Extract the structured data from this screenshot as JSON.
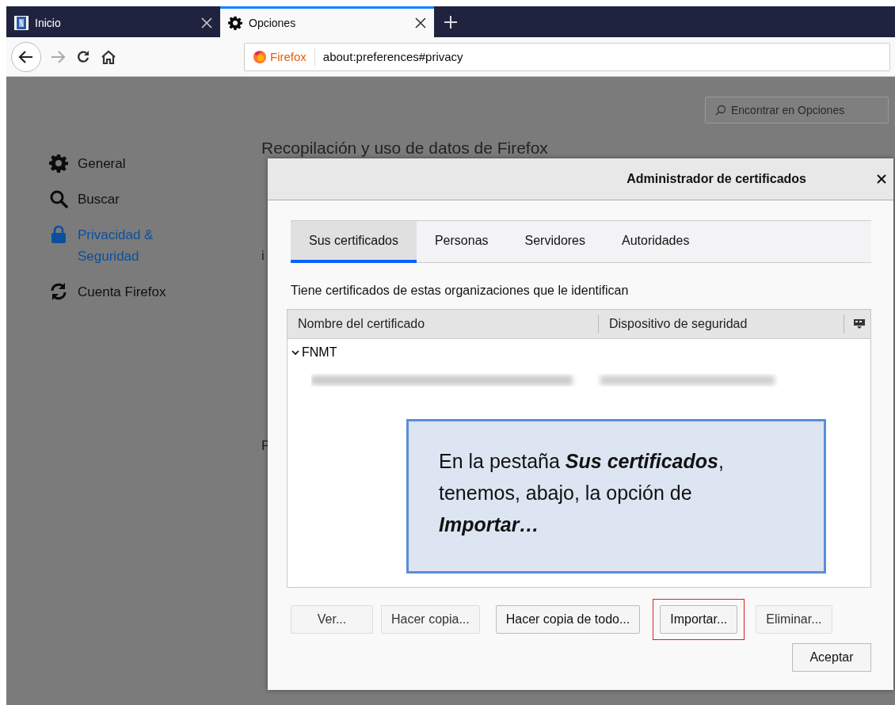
{
  "browser_tabs": [
    {
      "title": "Inicio",
      "kind": "site",
      "selected": false
    },
    {
      "title": "Opciones",
      "kind": "gear",
      "selected": true
    }
  ],
  "address_bar": {
    "identity": "Firefox",
    "url": "about:preferences#privacy"
  },
  "search": {
    "placeholder": "Encontrar en Opciones"
  },
  "sidebar": {
    "items": [
      {
        "label": "General",
        "kind": "gear",
        "selected": false
      },
      {
        "label": "Buscar",
        "kind": "search",
        "selected": false
      },
      {
        "label": "Privacidad & Seguridad",
        "kind": "lock",
        "selected": true
      },
      {
        "label": "Cuenta Firefox",
        "kind": "sync",
        "selected": false
      }
    ]
  },
  "background": {
    "heading": "Recopilación y uso de datos de Firefox",
    "fragments": [
      "i",
      "P"
    ]
  },
  "dialog": {
    "title": "Administrador de certificados",
    "tabs": [
      {
        "label": "Sus certificados",
        "selected": true
      },
      {
        "label": "Personas",
        "selected": false
      },
      {
        "label": "Servidores",
        "selected": false
      },
      {
        "label": "Autoridades",
        "selected": false
      }
    ],
    "description": "Tiene certificados de estas organizaciones que le identifican",
    "columns": [
      "Nombre del certificado",
      "Dispositivo de seguridad"
    ],
    "groups": [
      {
        "name": "FNMT",
        "expanded": true
      }
    ],
    "buttons": [
      {
        "label": "Ver...",
        "disabled": true,
        "highlighted": false
      },
      {
        "label": "Hacer copia...",
        "disabled": true,
        "highlighted": false
      },
      {
        "label": "Hacer copia de todo...",
        "disabled": false,
        "highlighted": false
      },
      {
        "label": "Importar...",
        "disabled": false,
        "highlighted": true
      },
      {
        "label": "Eliminar...",
        "disabled": true,
        "highlighted": false
      }
    ],
    "ok_button": "Aceptar"
  },
  "callout": {
    "text": "En la pestaña **Sus certificados**, tenemos, abajo, la opción de **Importar…**"
  }
}
